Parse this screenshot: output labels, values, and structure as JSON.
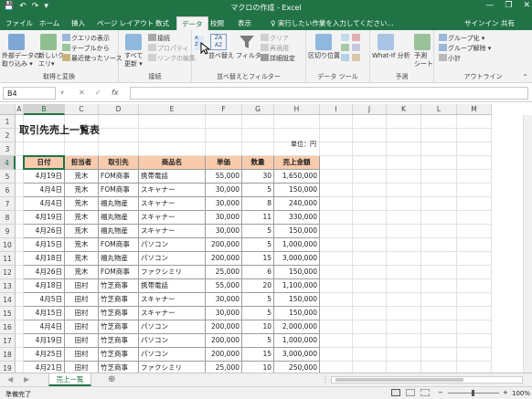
{
  "window": {
    "title": "マクロの作成 - Excel",
    "minimize_glyph": "—",
    "restore_glyph": "❐",
    "close_glyph": "✕"
  },
  "qat": {
    "save_glyph": "💾",
    "undo_glyph": "↶",
    "redo_glyph": "↷",
    "more_glyph": "▾"
  },
  "tabs": [
    "ファイル",
    "ホーム",
    "挿入",
    "ページ レイアウト",
    "数式",
    "データ",
    "校閲",
    "表示"
  ],
  "active_tab": "データ",
  "tellme": "♀ 実行したい作業を入力してください...",
  "signin": "サインイン",
  "share": "共有",
  "ribbon": {
    "get_external": {
      "label1": "外部データの",
      "label2": "取り込み ▾"
    },
    "new_query": {
      "label1": "新しいク",
      "label2": "エリ▾"
    },
    "query_small": [
      "クエリの表示",
      "テーブルから",
      "最近使ったソース"
    ],
    "group1": "取得と変換",
    "refresh": {
      "label1": "すべて",
      "label2": "更新 ▾"
    },
    "conn_small": [
      "接続",
      "プロパティ",
      "リンクの編集"
    ],
    "group2": "接続",
    "sort_label": "並べ替え",
    "filter_label": "フィルター",
    "filter_small": [
      "クリア",
      "再適用",
      "詳細設定"
    ],
    "group3": "並べ替えとフィルター",
    "text_to_cols": "区切り位置",
    "group4": "データ ツール",
    "whatif": "What-If 分析",
    "forecast": {
      "label1": "予測",
      "label2": "シート"
    },
    "group5": "予測",
    "outline_small": [
      "グループ化 ▾",
      "グループ解除 ▾",
      "小計"
    ],
    "group6": "アウトライン",
    "collapse_glyph": "⌃"
  },
  "formula_bar": {
    "name_box": "B4",
    "cancel": "✕",
    "enter": "✓",
    "fx": "fx",
    "value": ""
  },
  "columns": [
    "A",
    "B",
    "C",
    "D",
    "E",
    "F",
    "G",
    "H",
    "I",
    "J",
    "K",
    "L",
    "M"
  ],
  "rows": [
    "1",
    "2",
    "3",
    "4",
    "5",
    "6",
    "7",
    "8",
    "9",
    "10",
    "11",
    "12",
    "13",
    "14",
    "15",
    "16",
    "17",
    "18",
    "19"
  ],
  "sheet": {
    "title": "取引先売上一覧表",
    "unit": "単位：円",
    "headers": [
      "日付",
      "担当者",
      "取引先",
      "商品名",
      "単価",
      "数量",
      "売上金額"
    ],
    "data": [
      [
        "4月19日",
        "荒木",
        "FOM商事",
        "携帯電話",
        "55,000",
        "30",
        "1,650,000"
      ],
      [
        "4月4日",
        "荒木",
        "FOM商事",
        "スキャナー",
        "30,000",
        "5",
        "150,000"
      ],
      [
        "4月4日",
        "荒木",
        "福丸物産",
        "スキャナー",
        "30,000",
        "8",
        "240,000"
      ],
      [
        "4月19日",
        "荒木",
        "福丸物産",
        "スキャナー",
        "30,000",
        "11",
        "330,000"
      ],
      [
        "4月26日",
        "荒木",
        "福丸物産",
        "スキャナー",
        "30,000",
        "5",
        "150,000"
      ],
      [
        "4月15日",
        "荒木",
        "FOM商事",
        "パソコン",
        "200,000",
        "5",
        "1,000,000"
      ],
      [
        "4月18日",
        "荒木",
        "福丸物産",
        "パソコン",
        "200,000",
        "15",
        "3,000,000"
      ],
      [
        "4月26日",
        "荒木",
        "FOM商事",
        "ファクシミリ",
        "25,000",
        "6",
        "150,000"
      ],
      [
        "4月18日",
        "田村",
        "竹芝商事",
        "携帯電話",
        "55,000",
        "20",
        "1,100,000"
      ],
      [
        "4月5日",
        "田村",
        "竹芝商事",
        "スキャナー",
        "30,000",
        "5",
        "150,000"
      ],
      [
        "4月15日",
        "田村",
        "竹芝商事",
        "スキャナー",
        "30,000",
        "5",
        "150,000"
      ],
      [
        "4月4日",
        "田村",
        "竹芝商事",
        "パソコン",
        "200,000",
        "10",
        "2,000,000"
      ],
      [
        "4月19日",
        "田村",
        "竹芝商事",
        "パソコン",
        "200,000",
        "5",
        "1,000,000"
      ],
      [
        "4月25日",
        "田村",
        "竹芝商事",
        "パソコン",
        "200,000",
        "15",
        "3,000,000"
      ],
      [
        "4月21日",
        "田村",
        "竹芝商事",
        "ファクシミリ",
        "25,000",
        "10",
        "250,000"
      ]
    ]
  },
  "sheet_tabs": {
    "name": "売上一覧",
    "prev": "◀",
    "next": "▶",
    "add": "⊕",
    "more": "⋮"
  },
  "status": {
    "ready": "準備完了",
    "zoom": "100%",
    "minus": "−",
    "plus": "+"
  },
  "colors": {
    "excel_green": "#217346",
    "header_fill": "#f8cbad"
  }
}
